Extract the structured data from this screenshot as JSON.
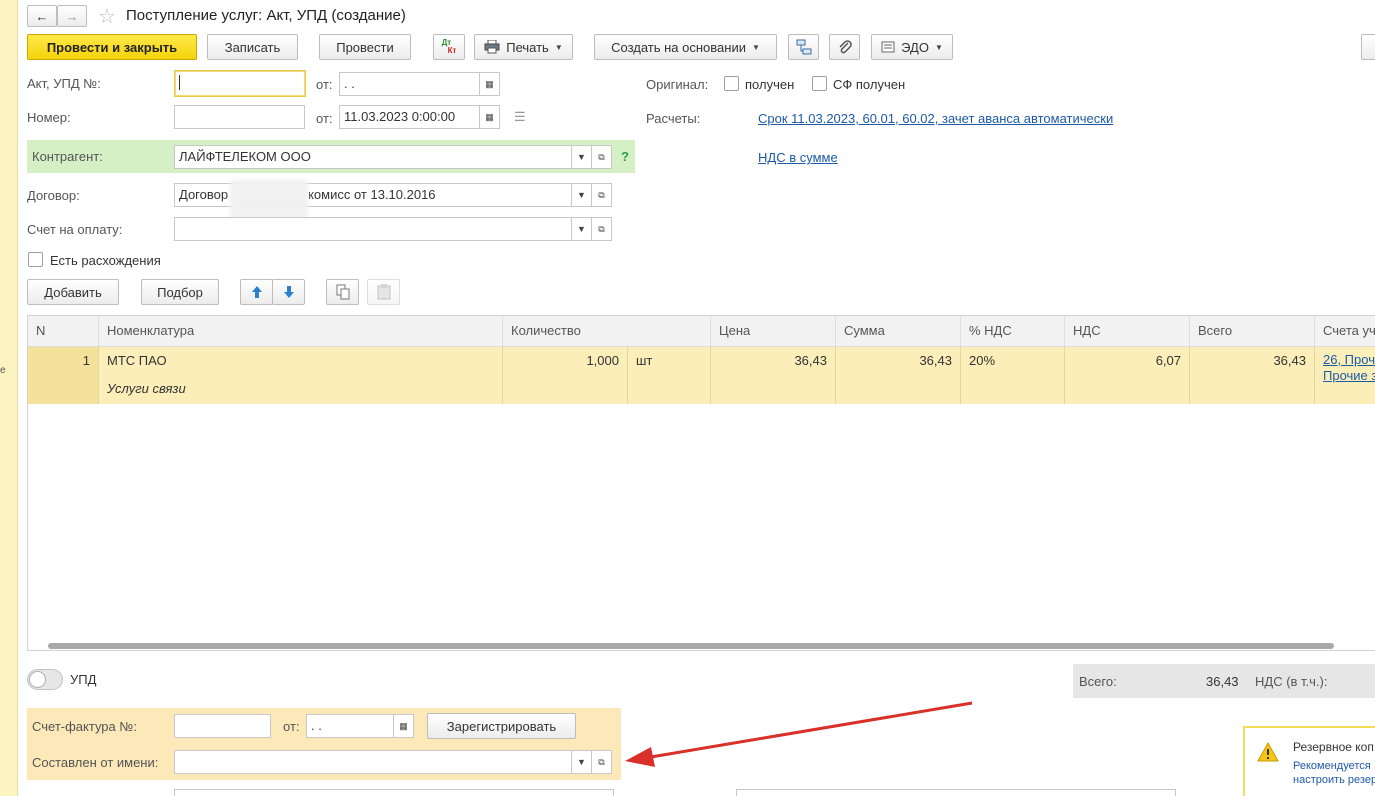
{
  "window": {
    "title": "Поступление услуг: Акт, УПД (создание)",
    "star": "☆"
  },
  "toolbar": {
    "post_close": "Провести и закрыть",
    "save": "Записать",
    "post": "Провести",
    "dtkt_top": "Дт",
    "dtkt_bottom": "Кт",
    "print": "Печать",
    "create_based": "Создать на основании",
    "edo": "ЭДО"
  },
  "header": {
    "act_label": "Акт, УПД №:",
    "act_value": "",
    "act_from_label": "от:",
    "act_date": " .  .",
    "number_label": "Номер:",
    "number_value": "",
    "number_from_label": "от:",
    "number_date": "11.03.2023  0:00:00",
    "original_label": "Оригинал:",
    "received_label": "получен",
    "sf_received_label": "СФ получен",
    "settlements_label": "Расчеты:",
    "settlements_link": "Срок 11.03.2023, 60.01, 60.02, зачет аванса автоматически",
    "vat_link": "НДС в сумме",
    "counterparty_label": "Контрагент:",
    "counterparty_value": "ЛАЙФТЕЛЕКОМ ООО",
    "help": "?",
    "contract_label": "Договор:",
    "contract_value_start": "Договор",
    "contract_value_end": "комисс от 13.10.2016",
    "invoice_label": "Счет на оплату:",
    "invoice_value": "",
    "discrepancy_label": "Есть расхождения"
  },
  "table_toolbar": {
    "add": "Добавить",
    "select": "Подбор"
  },
  "table": {
    "headers": [
      "N",
      "Номенклатура",
      "Количество",
      "Цена",
      "Сумма",
      "% НДС",
      "НДС",
      "Всего",
      "Счета уч"
    ],
    "rows": [
      {
        "n": "1",
        "name": "МТС ПАО",
        "subname": "Услуги связи",
        "qty": "1,000",
        "unit": "шт",
        "price": "36,43",
        "sum": "36,43",
        "vat_rate": "20%",
        "vat": "6,07",
        "total": "36,43",
        "account_link1": "26, Проч",
        "account_link2": "Прочие з"
      }
    ]
  },
  "footer": {
    "upd_label": "УПД",
    "total_label": "Всего:",
    "total_value": "36,43",
    "vat_incl_label": "НДС (в т.ч.):",
    "sf_label": "Счет-фактура №:",
    "sf_value": "",
    "sf_from_label": "от:",
    "sf_date": " .  .",
    "register_button": "Зарегистрировать",
    "composed_label": "Составлен от имени:",
    "composed_value": ""
  },
  "notification": {
    "title": "Резервное коп",
    "line1": "Рекомендуется",
    "line2": "настроить резер"
  },
  "colors": {
    "primary": "#f5d309",
    "link": "#1e5aa8",
    "row_highlight": "#fbeeb8",
    "green_row": "#d5f0c5",
    "arrow": "#d9302a"
  }
}
